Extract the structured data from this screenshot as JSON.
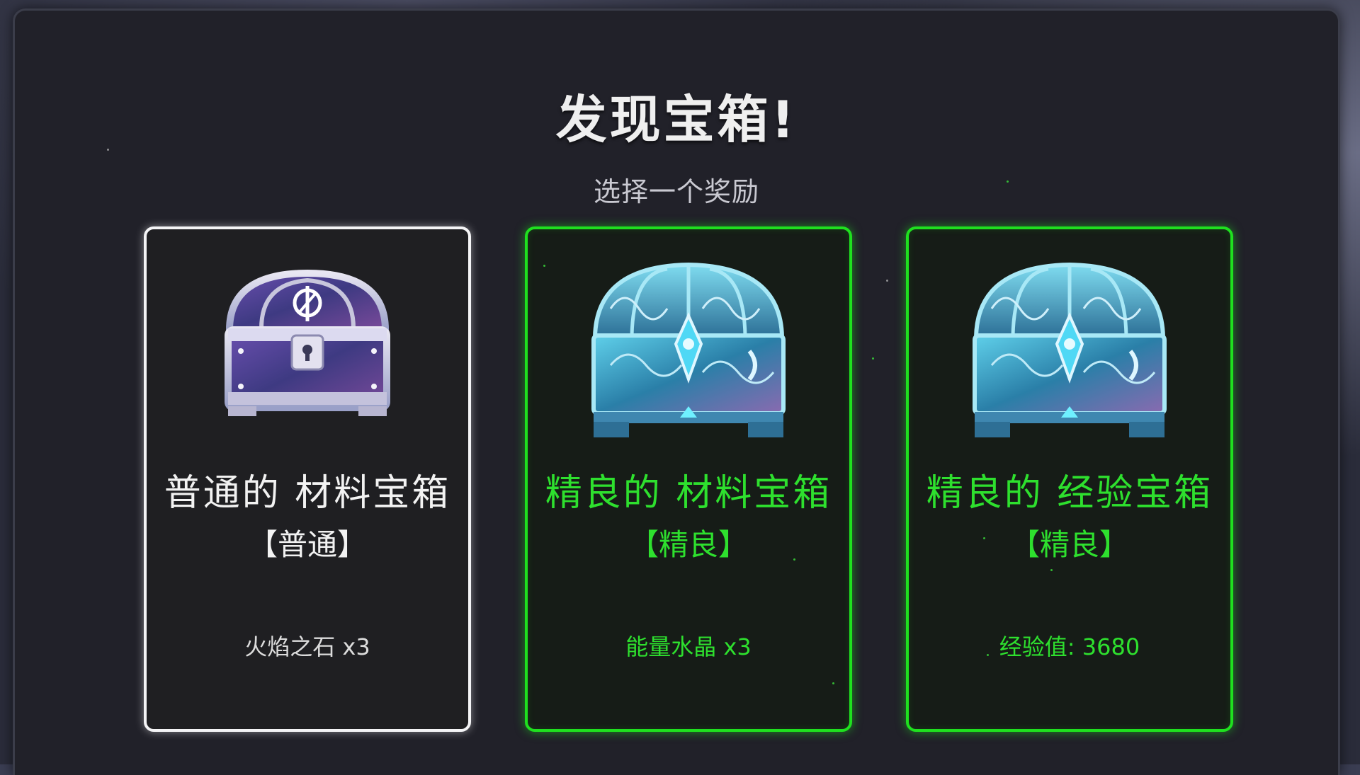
{
  "dialog": {
    "title": "发现宝箱!",
    "subtitle": "选择一个奖励"
  },
  "cards": [
    {
      "name": "普通的 材料宝箱",
      "rarity": "【普通】",
      "reward": "火焰之石 x3",
      "rarity_color": "#f2f2f2",
      "chest_icon": "common-chest-icon"
    },
    {
      "name": "精良的 材料宝箱",
      "rarity": "【精良】",
      "reward": "能量水晶 x3",
      "rarity_color": "#2ee02e",
      "chest_icon": "fine-chest-icon"
    },
    {
      "name": "精良的 经验宝箱",
      "rarity": "【精良】",
      "reward": "经验值: 3680",
      "rarity_color": "#2ee02e",
      "chest_icon": "fine-chest-icon"
    }
  ],
  "colors": {
    "panel_bg": "#212129",
    "common_border": "#f4f4f6",
    "fine_border": "#1fe01f"
  }
}
